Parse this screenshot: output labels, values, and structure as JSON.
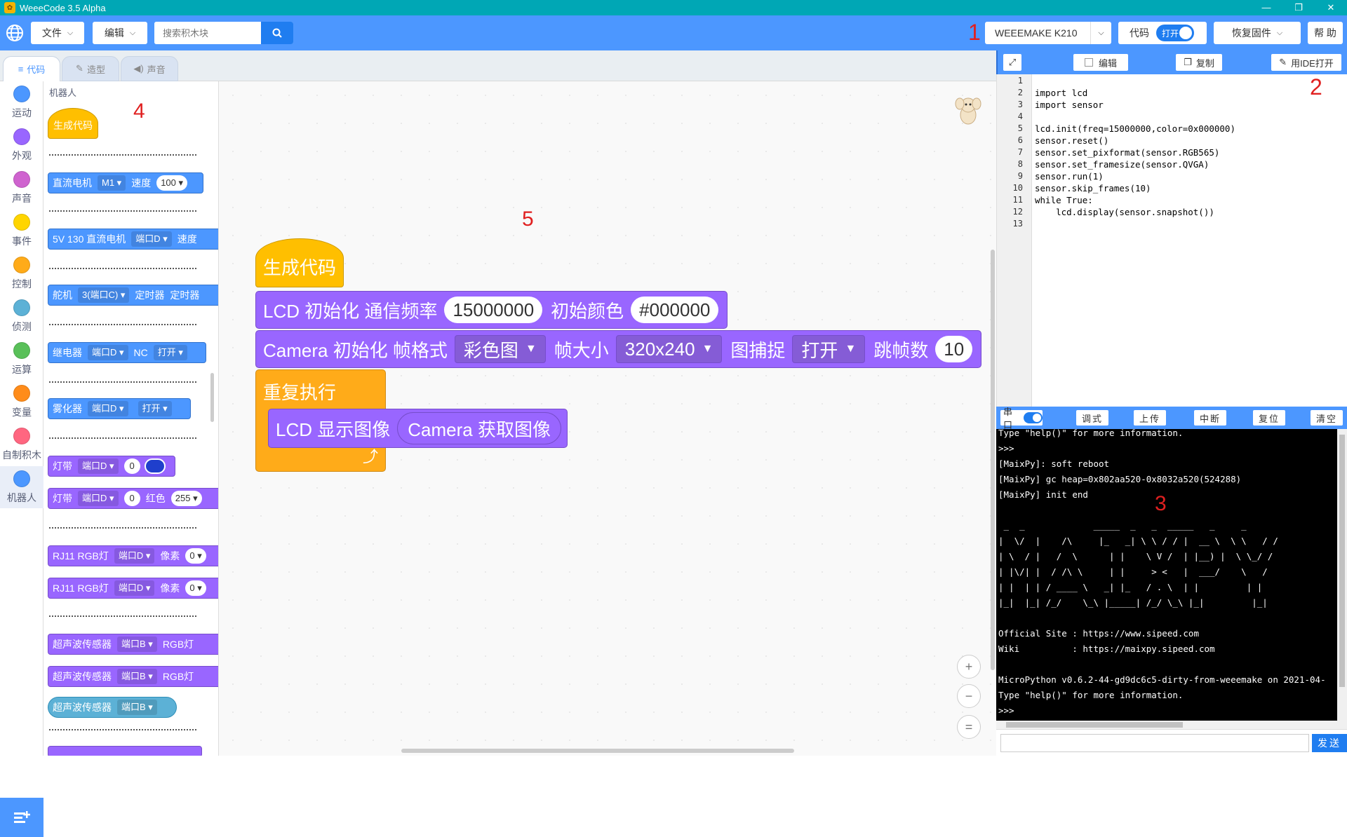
{
  "window": {
    "title": "WeeeCode 3.5 Alpha",
    "min": "—",
    "max": "❐",
    "close": "✕"
  },
  "menu": {
    "file_label": "文件",
    "edit_label": "编辑",
    "search_placeholder": "搜索积木块",
    "device_label": "WEEEMAKE K210",
    "code_label": "代码",
    "code_toggle": "打开",
    "restore_label": "恢复固件",
    "help_label": "帮 助"
  },
  "annotations": {
    "a1": "1",
    "a2": "2",
    "a3": "3",
    "a4": "4",
    "a5": "5"
  },
  "tabs": [
    {
      "label": "代码"
    },
    {
      "label": "造型"
    },
    {
      "label": "声音"
    }
  ],
  "categories": [
    {
      "label": "运动",
      "color": "#4c97ff"
    },
    {
      "label": "外观",
      "color": "#9966ff"
    },
    {
      "label": "声音",
      "color": "#cf63cf"
    },
    {
      "label": "事件",
      "color": "#ffd500"
    },
    {
      "label": "控制",
      "color": "#ffab19"
    },
    {
      "label": "侦测",
      "color": "#5cb1d6"
    },
    {
      "label": "运算",
      "color": "#59c059"
    },
    {
      "label": "变量",
      "color": "#ff8c1a"
    },
    {
      "label": "自制积木",
      "color": "#ff6680"
    },
    {
      "label": "机器人",
      "color": "#4c97ff"
    }
  ],
  "palette": {
    "section_title": "机器人",
    "hat_label": "生成代码",
    "dc_motor": {
      "label": "直流电机",
      "port": "M1",
      "speed_label": "速度",
      "speed": "100"
    },
    "dc5v": {
      "label": "5V 130 直流电机",
      "port": "端口D",
      "speed_label": "速度"
    },
    "servo": {
      "label": "舵机",
      "port": "3(端口C)",
      "timer_label": "定时器",
      "timer2": "定时器"
    },
    "relay": {
      "label": "继电器",
      "port": "端口D",
      "nc": "NC",
      "state": "打开"
    },
    "atomizer": {
      "label": "雾化器",
      "port": "端口D",
      "state": "打开"
    },
    "strip1": {
      "label": "灯带",
      "port": "端口D",
      "index": "0",
      "color": "#1f3fcc"
    },
    "strip2": {
      "label": "灯带",
      "port": "端口D",
      "index": "0",
      "red_label": "红色",
      "red": "255"
    },
    "rj11_1": {
      "label": "RJ11 RGB灯",
      "port": "端口D",
      "px_label": "像素",
      "px": "0"
    },
    "rj11_2": {
      "label": "RJ11 RGB灯",
      "port": "端口D",
      "px_label": "像素",
      "px": "0"
    },
    "ultra1": {
      "label": "超声波传感器",
      "port": "端口B",
      "rgb": "RGB灯"
    },
    "ultra2": {
      "label": "超声波传感器",
      "port": "端口B",
      "rgb": "RGB灯"
    },
    "ultra3": {
      "label": "超声波传感器",
      "port": "端口B"
    }
  },
  "workspace": {
    "hat": "生成代码",
    "lcd_init": {
      "label": "LCD 初始化 通信频率",
      "freq": "15000000",
      "color_label": "初始颜色",
      "color": "#000000"
    },
    "cam_init": {
      "label": "Camera 初始化 帧格式",
      "format": "彩色图",
      "size_label": "帧大小",
      "size": "320x240",
      "capture_label": "图捕捉",
      "capture": "打开",
      "skip_label": "跳帧数",
      "skip": "10"
    },
    "repeat": "重复执行",
    "lcd_display": {
      "label": "LCD 显示图像",
      "reporter": "Camera 获取图像"
    },
    "zoom_in": "+",
    "zoom_out": "−",
    "zoom_reset": "="
  },
  "code_toolbar": {
    "edit": "编辑",
    "copy": "复制",
    "open_ide": "用IDE打开"
  },
  "code_lines": [
    "",
    "import lcd",
    "import sensor",
    "",
    "lcd.init(freq=15000000,color=0x000000)",
    "sensor.reset()",
    "sensor.set_pixformat(sensor.RGB565)",
    "sensor.set_framesize(sensor.QVGA)",
    "sensor.run(1)",
    "sensor.skip_frames(10)",
    "while True:",
    "    lcd.display(sensor.snapshot())",
    ""
  ],
  "line_numbers": [
    "1",
    "2",
    "3",
    "4",
    "5",
    "6",
    "7",
    "8",
    "9",
    "10",
    "11",
    "12",
    "13"
  ],
  "serial_toolbar": {
    "port": "串口",
    "debug": "调式",
    "upload": "上传",
    "interrupt": "中断",
    "reset": "复位",
    "clear": "清空"
  },
  "terminal_lines": [
    "Type \"help()\" for more information.",
    ">>>",
    "[MaixPy]: soft reboot",
    "[MaixPy] gc heap=0x802aa520-0x8032a520(524288)",
    "[MaixPy] init end",
    "",
    " _  _             _____  _   _  _____   _     _",
    "|  \\/  |    /\\     |_   _| \\ \\ / / |  __ \\  \\ \\   / /",
    "| \\  / |   /  \\      | |    \\ V /  | |__) |  \\ \\_/ /",
    "| |\\/| |  / /\\ \\     | |     > <   |  ___/    \\   /",
    "| |  | | / ____ \\   _| |_   / . \\  | |         | |",
    "|_|  |_| /_/    \\_\\ |_____| /_/ \\_\\ |_|         |_|",
    "",
    "Official Site : https://www.sipeed.com",
    "Wiki          : https://maixpy.sipeed.com",
    "",
    "MicroPython v0.6.2-44-gd9dc6c5-dirty-from-weeemake on 2021-04-",
    "Type \"help()\" for more information.",
    ">>>"
  ],
  "send_label": "发送"
}
